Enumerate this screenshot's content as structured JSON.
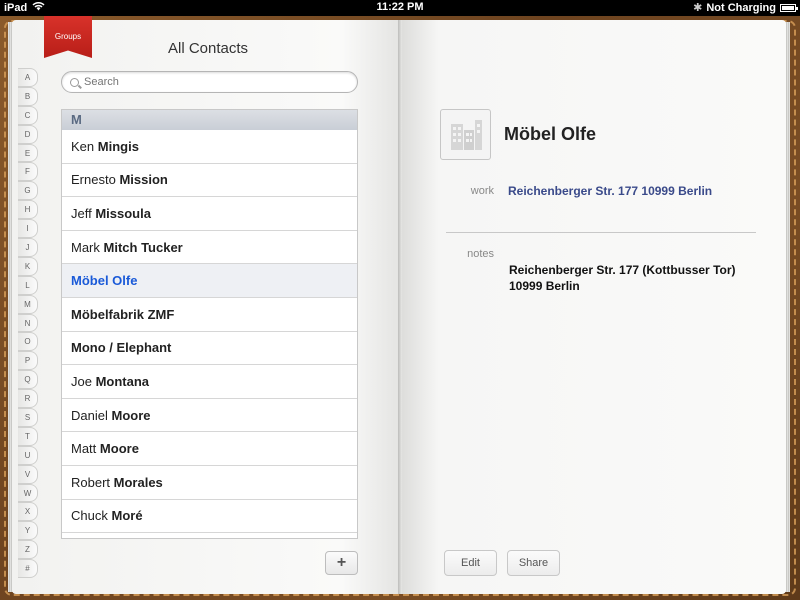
{
  "status": {
    "device": "iPad",
    "time": "11:22 PM",
    "charging": "Not Charging"
  },
  "header": {
    "groups_label": "Groups",
    "title": "All Contacts",
    "search_placeholder": "Search"
  },
  "index": [
    "A",
    "B",
    "C",
    "D",
    "E",
    "F",
    "G",
    "H",
    "I",
    "J",
    "K",
    "L",
    "M",
    "N",
    "O",
    "P",
    "Q",
    "R",
    "S",
    "T",
    "U",
    "V",
    "W",
    "X",
    "Y",
    "Z",
    "#"
  ],
  "list": {
    "section": "M",
    "contacts": [
      {
        "first": "Ken",
        "last": "Mingis"
      },
      {
        "first": "Ernesto",
        "last": "Mission"
      },
      {
        "first": "Jeff",
        "last": "Missoula"
      },
      {
        "first": "Mark",
        "last": "Mitch Tucker"
      },
      {
        "first": "",
        "last": "Möbel Olfe"
      },
      {
        "first": "",
        "last": "Möbelfabrik ZMF"
      },
      {
        "first": "",
        "last": "Mono / Elephant"
      },
      {
        "first": "Joe",
        "last": "Montana"
      },
      {
        "first": "Daniel",
        "last": "Moore"
      },
      {
        "first": "Matt",
        "last": "Moore"
      },
      {
        "first": "Robert",
        "last": "Morales"
      },
      {
        "first": "Chuck",
        "last": "Moré"
      }
    ],
    "selected_index": 4,
    "add_label": "+"
  },
  "detail": {
    "name": "Möbel Olfe",
    "work_label": "work",
    "work_value": "Reichenberger Str. 177 10999 Berlin",
    "notes_label": "notes",
    "notes_line1": "Reichenberger Str. 177 (Kottbusser Tor)",
    "notes_line2": "10999 Berlin",
    "edit_label": "Edit",
    "share_label": "Share"
  }
}
